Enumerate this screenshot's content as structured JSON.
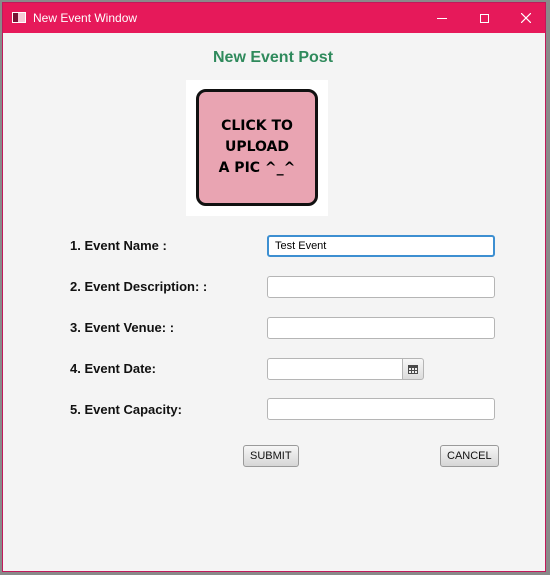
{
  "window": {
    "title": "New Event Window",
    "title_bar_color": "#e6195a"
  },
  "form": {
    "heading": "New Event Post",
    "heading_color": "#2f8a5c",
    "upload_button_text": "CLICK TO\nUPLOAD\nA PIC ^_^",
    "upload_button_color": "#e9a4b2",
    "fields": [
      {
        "label": "1. Event Name :",
        "value": "Test Event",
        "focused": true
      },
      {
        "label": "2. Event Description: :",
        "value": ""
      },
      {
        "label": "3. Event Venue: :",
        "value": ""
      },
      {
        "label": "4. Event Date:",
        "value": "",
        "icon": "calendar-icon"
      },
      {
        "label": "5. Event Capacity:",
        "value": ""
      }
    ],
    "submit_label": "SUBMIT",
    "cancel_label": "CANCEL"
  }
}
